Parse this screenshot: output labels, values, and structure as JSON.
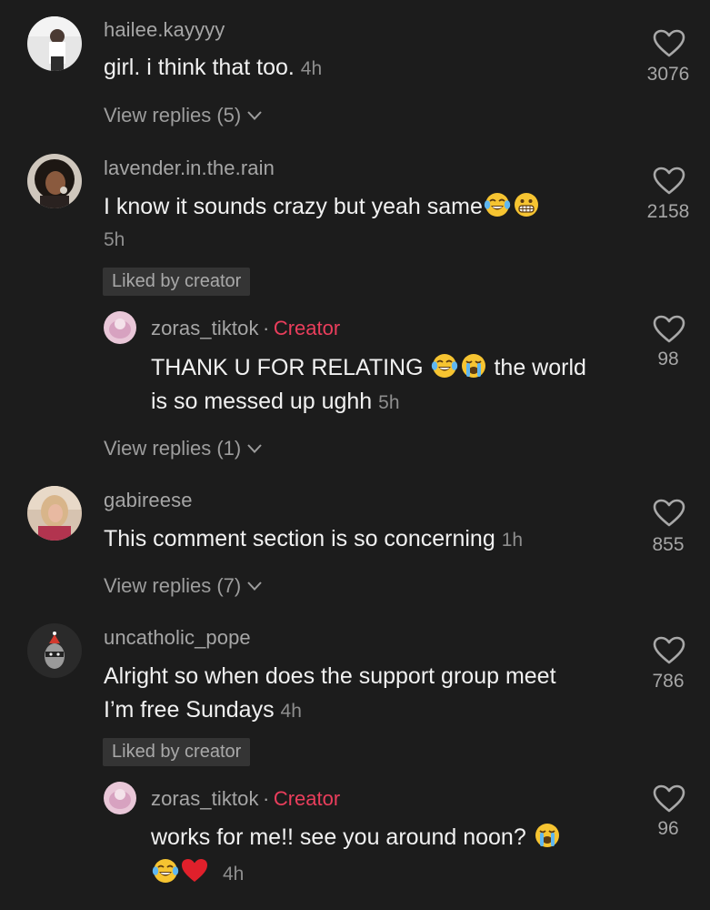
{
  "colors": {
    "background": "#1c1c1c",
    "username": "#a6a6a6",
    "creator_accent": "#ea3e5c",
    "comment_text": "#f1f1f1",
    "badge_bg": "#343434"
  },
  "comments": [
    {
      "username": "hailee.kayyyy",
      "text": "girl. i think that too.",
      "time": "4h",
      "likes": "3076",
      "view_replies": "View replies (5)"
    },
    {
      "username": "lavender.in.the.rain",
      "text": "I know it sounds crazy but yeah same",
      "emojis": [
        "face-with-tears-of-joy",
        "grimacing-face"
      ],
      "time": "5h",
      "likes": "2158",
      "badge": "Liked by creator",
      "reply": {
        "username": "zoras_tiktok",
        "separator": "·",
        "creator_label": "Creator",
        "text_a": "THANK U FOR RELATING",
        "emojis": [
          "face-with-tears-of-joy",
          "loudly-crying-face"
        ],
        "text_b": "the world",
        "text_c": "is so messed up ughh",
        "time": "5h",
        "likes": "98"
      },
      "view_replies": "View replies (1)"
    },
    {
      "username": "gabireese",
      "text": "This comment section is so concerning",
      "time": "1h",
      "likes": "855",
      "view_replies": "View replies (7)"
    },
    {
      "username": "uncatholic_pope",
      "text_a": "Alright so when does the support group meet",
      "text_b": "I’m free Sundays",
      "time": "4h",
      "likes": "786",
      "badge": "Liked by creator",
      "reply": {
        "username": "zoras_tiktok",
        "separator": "·",
        "creator_label": "Creator",
        "text_a": "works for me!! see you around noon?",
        "emojis_a": [
          "loudly-crying-face"
        ],
        "emojis_b": [
          "face-with-tears-of-joy",
          "red-heart"
        ],
        "time": "4h",
        "likes": "96"
      }
    }
  ]
}
